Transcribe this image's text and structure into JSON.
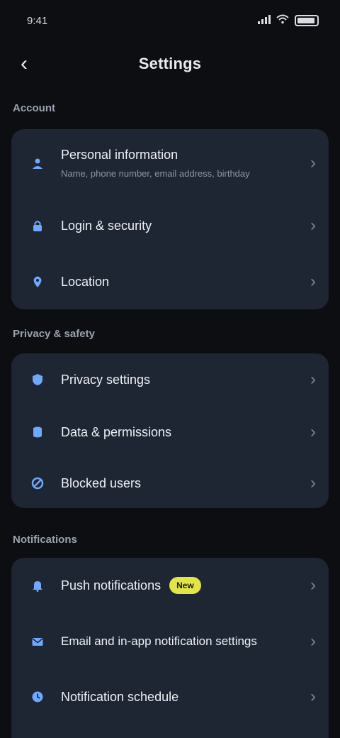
{
  "status_bar": {
    "time": "9:41",
    "signal_icon": "signal-icon",
    "wifi_icon": "wifi-icon",
    "battery_icon": "battery-icon",
    "battery_level": 0.8
  },
  "header": {
    "title": "Settings",
    "back_icon": "chevron-left-icon"
  },
  "sections": [
    {
      "title": "Account",
      "items": [
        {
          "label": "Personal information",
          "subtitle": "Name, phone number, email address, birthday",
          "icon": "person-icon"
        },
        {
          "label": "Login & security",
          "icon": "lock-icon"
        },
        {
          "label": "Location",
          "icon": "location-icon"
        }
      ]
    },
    {
      "title": "Privacy & safety",
      "items": [
        {
          "label": "Privacy settings",
          "icon": "shield-icon"
        },
        {
          "label": "Data & permissions",
          "icon": "database-icon"
        },
        {
          "label": "Blocked users",
          "icon": "block-icon"
        }
      ]
    },
    {
      "title": "Notifications",
      "items": [
        {
          "label": "Push notifications",
          "badge": "New",
          "icon": "bell-icon"
        },
        {
          "label": "Email and in-app notification settings",
          "icon": "mail-icon"
        },
        {
          "label": "Notification schedule",
          "icon": "clock-icon"
        }
      ]
    }
  ],
  "colors": {
    "background": "#0d0e11",
    "card": "#1e2533",
    "accent": "#6fa8ff",
    "badge": "#e2e44a"
  }
}
